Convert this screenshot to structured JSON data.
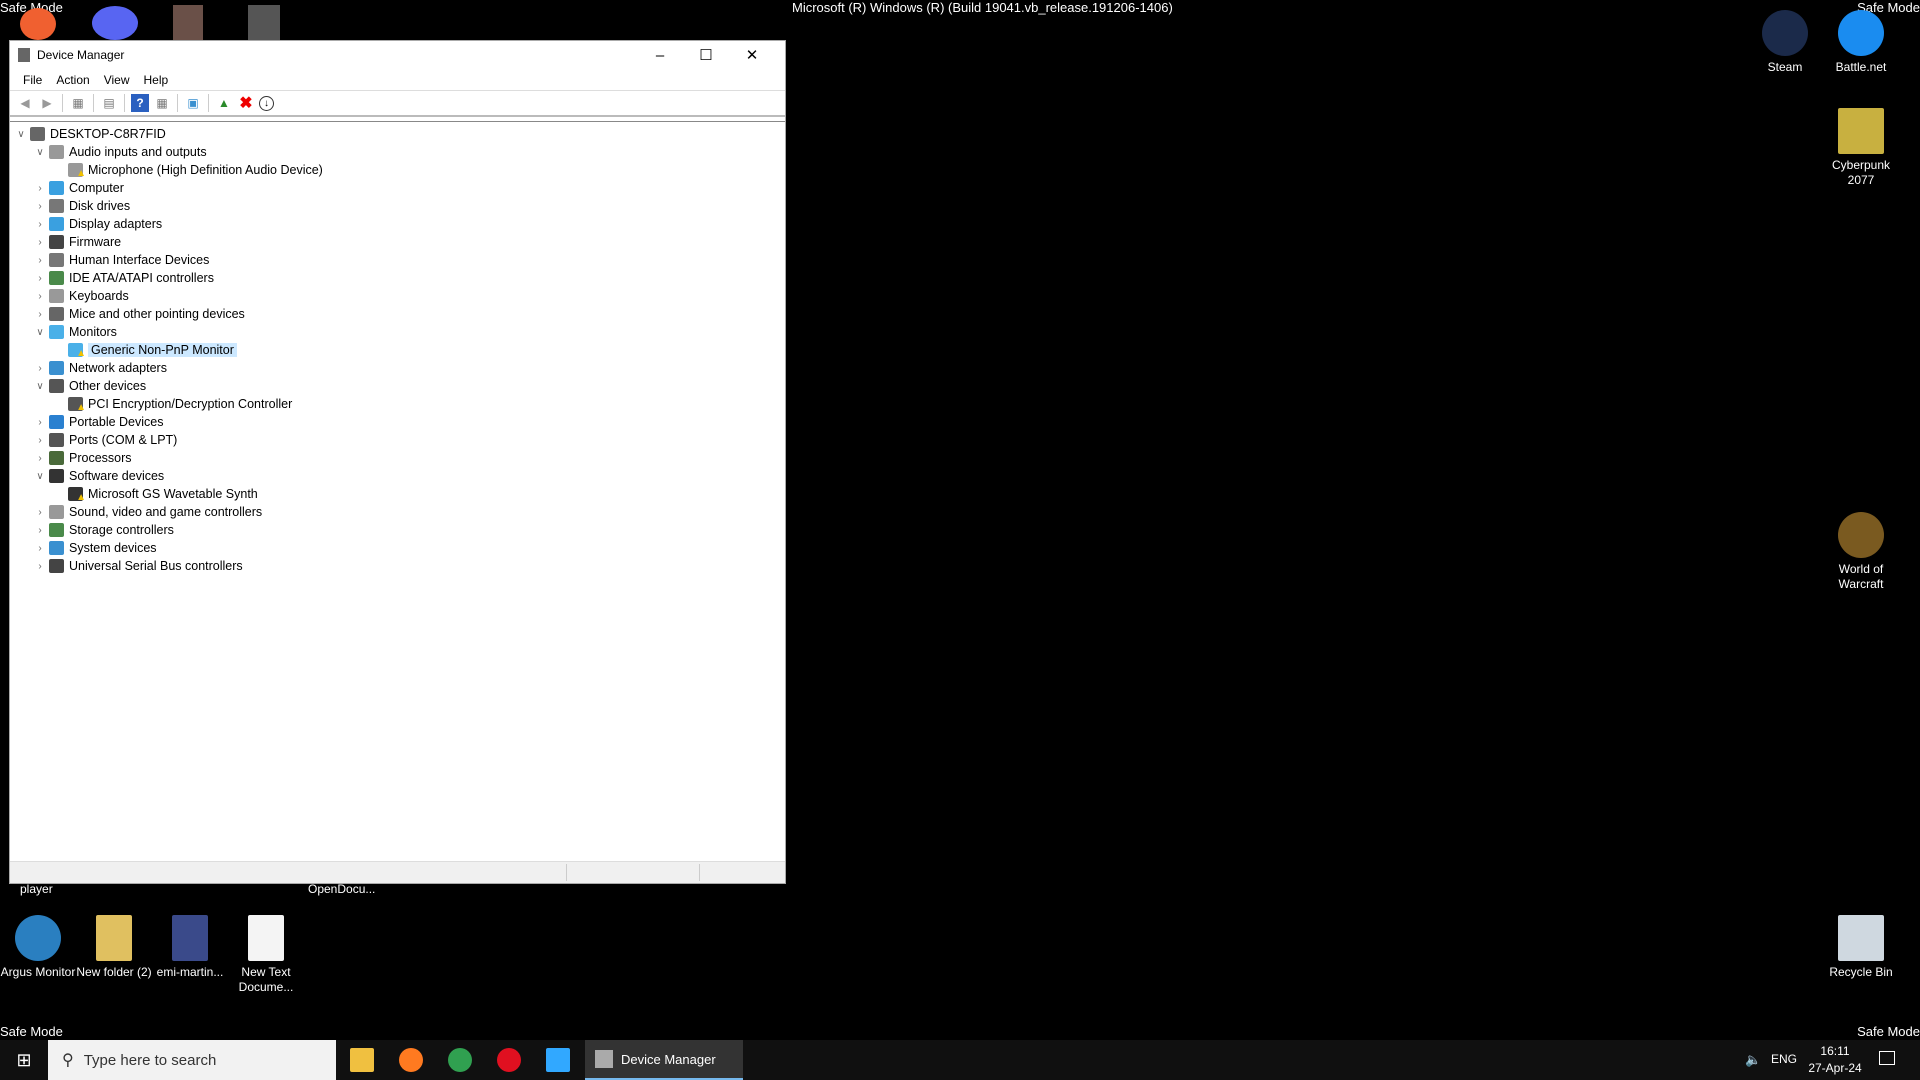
{
  "desktop": {
    "safe_mode": "Safe Mode",
    "build": "Microsoft (R) Windows (R) (Build 19041.vb_release.191206-1406)",
    "partial_labels": [
      "player",
      "OpenDocu..."
    ],
    "left_icons": [
      {
        "label": "Argus Monitor",
        "color": "#2a7fc0"
      },
      {
        "label": "New folder (2)",
        "color": "#e0c060"
      },
      {
        "label": "emi-martin...",
        "color": "#3a4a8a"
      },
      {
        "label": "New Text Docume...",
        "color": "#f4f4f4"
      }
    ],
    "right_icons": [
      {
        "label": "Steam",
        "color": "#1b2a4a"
      },
      {
        "label": "Battle.net",
        "color": "#1a8cf0"
      },
      {
        "label": "Cyberpunk 2077",
        "color": "#c8b040"
      },
      {
        "label": "World of Warcraft",
        "color": "#7a5a20"
      },
      {
        "label": "Recycle Bin",
        "color": "#cfd8e0"
      }
    ]
  },
  "window": {
    "title": "Device Manager",
    "menu": [
      "File",
      "Action",
      "View",
      "Help"
    ],
    "computer": "DESKTOP-C8R7FID",
    "tree": [
      {
        "label": "Audio inputs and outputs",
        "expanded": true,
        "icon": "#999",
        "children": [
          "Microphone (High Definition Audio Device)"
        ]
      },
      {
        "label": "Computer",
        "icon": "#3aa0e0"
      },
      {
        "label": "Disk drives",
        "icon": "#777"
      },
      {
        "label": "Display adapters",
        "icon": "#3aa0e0"
      },
      {
        "label": "Firmware",
        "icon": "#444"
      },
      {
        "label": "Human Interface Devices",
        "icon": "#777"
      },
      {
        "label": "IDE ATA/ATAPI controllers",
        "icon": "#4a8a4a"
      },
      {
        "label": "Keyboards",
        "icon": "#999"
      },
      {
        "label": "Mice and other pointing devices",
        "icon": "#666"
      },
      {
        "label": "Monitors",
        "expanded": true,
        "icon": "#4ab0e8",
        "children": [
          "Generic Non-PnP Monitor"
        ],
        "selected_child": 0
      },
      {
        "label": "Network adapters",
        "icon": "#3a90d0"
      },
      {
        "label": "Other devices",
        "expanded": true,
        "icon": "#555",
        "children": [
          "PCI Encryption/Decryption Controller"
        ]
      },
      {
        "label": "Portable Devices",
        "icon": "#2a80d0"
      },
      {
        "label": "Ports (COM & LPT)",
        "icon": "#555"
      },
      {
        "label": "Processors",
        "icon": "#4a6a3a"
      },
      {
        "label": "Software devices",
        "expanded": true,
        "icon": "#333",
        "children": [
          "Microsoft GS Wavetable Synth"
        ]
      },
      {
        "label": "Sound, video and game controllers",
        "icon": "#999"
      },
      {
        "label": "Storage controllers",
        "icon": "#4a8a4a"
      },
      {
        "label": "System devices",
        "icon": "#3a90d0"
      },
      {
        "label": "Universal Serial Bus controllers",
        "icon": "#444"
      }
    ],
    "warning_color": "#f0c000"
  },
  "taskbar": {
    "search_placeholder": "Type here to search",
    "apps": [
      {
        "name": "file-explorer",
        "color": "#f0c040"
      },
      {
        "name": "firefox",
        "color": "#ff7a20"
      },
      {
        "name": "chrome",
        "color": "#30a050"
      },
      {
        "name": "opera",
        "color": "#e01020"
      },
      {
        "name": "photoshop",
        "color": "#31a8ff"
      }
    ],
    "active_app": "Device Manager",
    "lang": "ENG",
    "time": "16:11",
    "date": "27-Apr-24"
  }
}
